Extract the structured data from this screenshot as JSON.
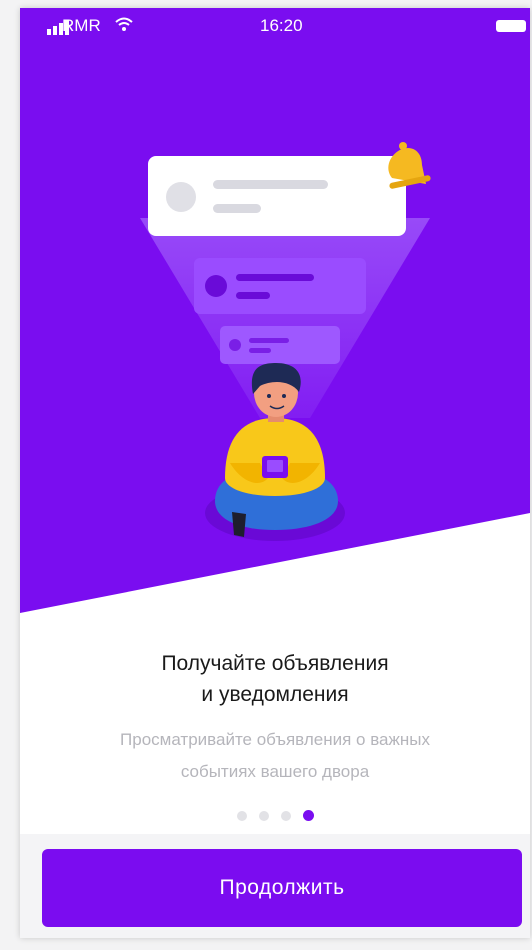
{
  "colors": {
    "accent": "#7b0cf0",
    "hero_bg": "#7a0df0",
    "title": "#1a1a1a",
    "subtitle": "#b5b5bb"
  },
  "status_bar": {
    "carrier": "RMR",
    "time": "16:20",
    "icons": [
      "signal-icon",
      "wifi-icon",
      "battery-icon"
    ]
  },
  "onboarding": {
    "title_line1": "Получайте объявления",
    "title_line2": "и уведомления",
    "subtitle_line1": "Просматривайте объявления о важных",
    "subtitle_line2": "событиях вашего двора",
    "page_count": 4,
    "current_page": 4
  },
  "footer": {
    "continue_label": "Продолжить"
  }
}
